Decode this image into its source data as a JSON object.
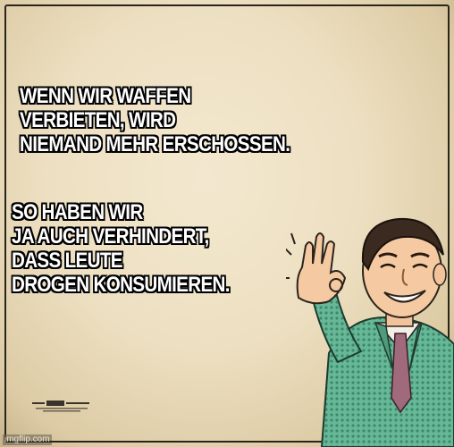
{
  "caption_top": {
    "lines": [
      "WENN WIR WAFFEN",
      "VERBIETEN, WIRD",
      "NIEMAND MEHR ERSCHOSSEN."
    ]
  },
  "caption_bottom": {
    "lines": [
      "SO HABEN WIR",
      "JA AUCH VERHINDERT,",
      "DASS LEUTE",
      "DROGEN KONSUMIEREN."
    ]
  },
  "watermark": "imgflip.com",
  "colors": {
    "background": "#eddfc1",
    "text": "#ffffff",
    "jacket": "#5fb08e",
    "tie": "#a16a7c"
  },
  "icons": [
    "ok-hand-icon"
  ]
}
